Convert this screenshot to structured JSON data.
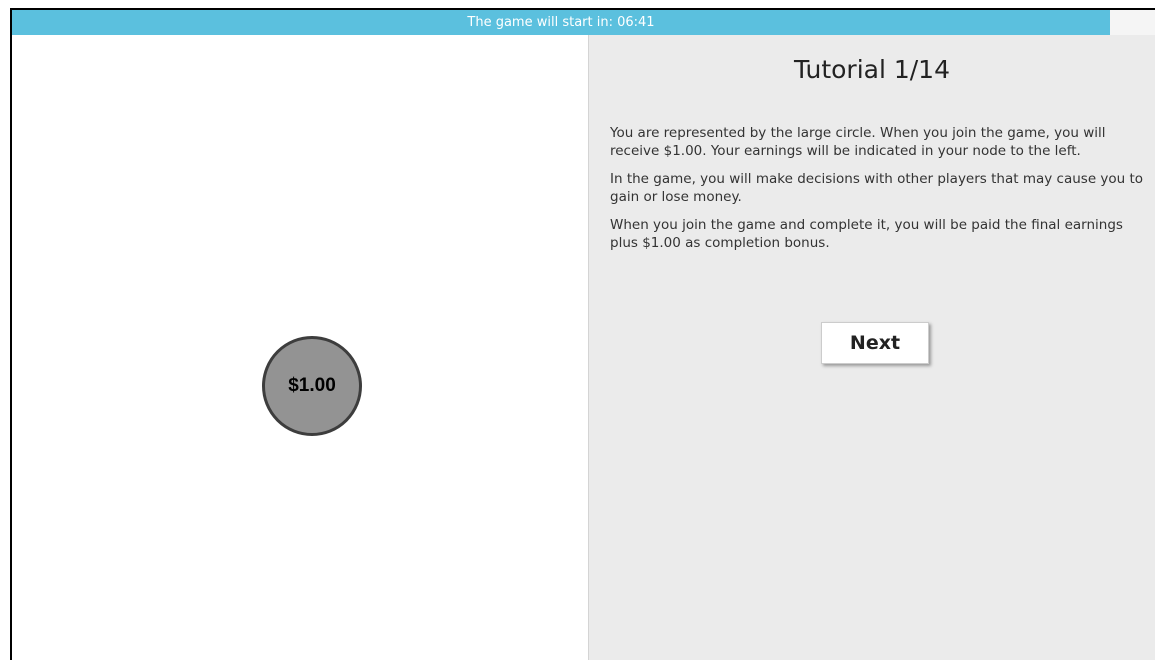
{
  "countdown": {
    "text": "The game will start in: 06:41",
    "color": "#5bc0de"
  },
  "player_node": {
    "earnings": "$1.00",
    "fill_color": "#939393"
  },
  "tutorial": {
    "title": "Tutorial 1/14",
    "paragraphs": [
      "You are represented by the large circle. When you join the game, you will receive $1.00. Your earnings will be indicated in your node to the left.",
      "In the game, you will make decisions with other players that may cause you to gain or lose money.",
      "When you join the game and complete it, you will be paid the final earnings plus $1.00 as completion bonus."
    ],
    "next_label": "Next",
    "panel_color": "#ebebeb"
  }
}
